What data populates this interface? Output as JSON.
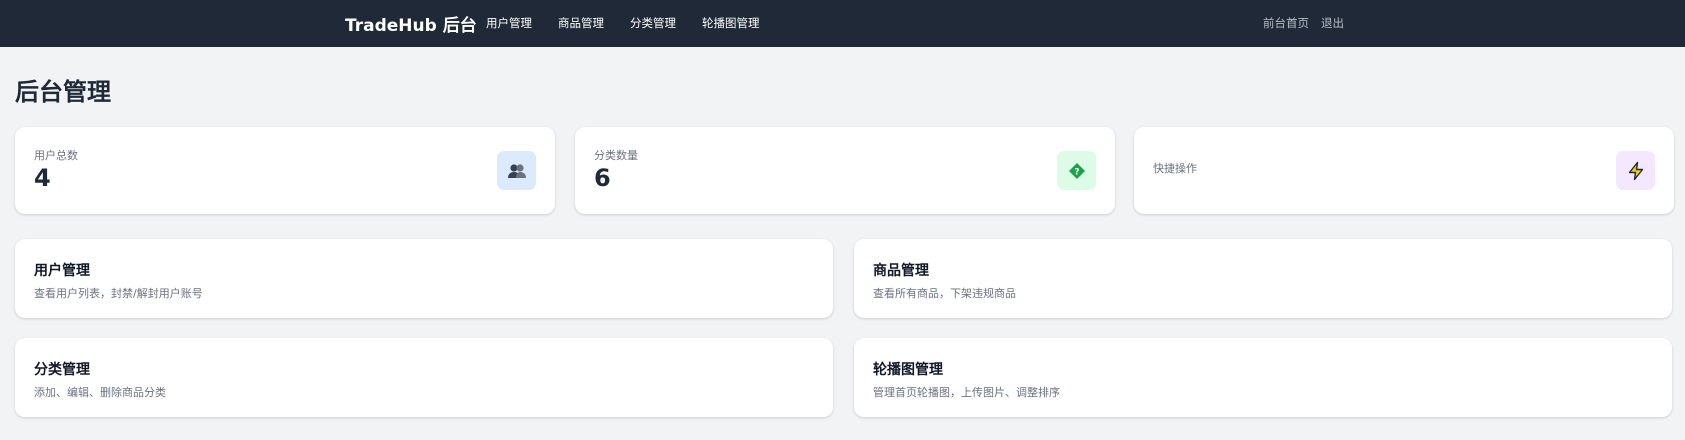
{
  "header": {
    "brand": "TradeHub 后台",
    "nav": [
      "用户管理",
      "商品管理",
      "分类管理",
      "轮播图管理"
    ],
    "right_links": [
      "前台首页",
      "退出"
    ],
    "background": "#1f2937"
  },
  "page_title": "后台管理",
  "stats": [
    {
      "label": "用户总数",
      "value": "4",
      "icon": "users-icon",
      "icon_bg": "#dbeafe"
    },
    {
      "label": "分类数量",
      "value": "6",
      "icon": "tag-icon",
      "icon_bg": "#dcfce7"
    },
    {
      "label": "快捷操作",
      "value": "",
      "icon": "lightning-icon",
      "icon_bg": "#f3e8ff"
    }
  ],
  "features": [
    {
      "title": "用户管理",
      "desc": "查看用户列表，封禁/解封用户账号"
    },
    {
      "title": "商品管理",
      "desc": "查看所有商品，下架违规商品"
    },
    {
      "title": "分类管理",
      "desc": "添加、编辑、删除商品分类"
    },
    {
      "title": "轮播图管理",
      "desc": "管理首页轮播图，上传图片、调整排序"
    }
  ]
}
